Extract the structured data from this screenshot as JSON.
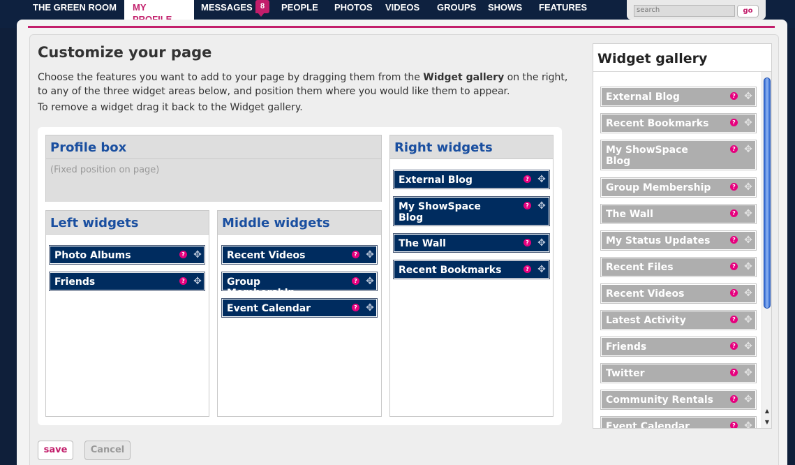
{
  "nav": {
    "items": [
      "THE GREEN ROOM",
      "MY PROFILE",
      "MESSAGES",
      "PEOPLE",
      "PHOTOS",
      "VIDEOS",
      "GROUPS",
      "SHOWS",
      "FEATURES"
    ],
    "active_line1": "MY",
    "active_line2": "PROFILE",
    "messages_count": "8",
    "search_placeholder": "search",
    "search_button": "go"
  },
  "page": {
    "title": "Customize your page",
    "intro_part1": "Choose the features you want to add to your page by dragging them from the ",
    "intro_bold": "Widget gallery",
    "intro_part2": " on the right, to any of the three widget areas below, and position them where you would like them to appear.",
    "intro2": "To remove a widget drag it back to the Widget gallery."
  },
  "zones": {
    "profile": {
      "title": "Profile box",
      "note": "(Fixed position on page)"
    },
    "left": {
      "title": "Left widgets",
      "widgets": [
        "Photo Albums",
        "Friends"
      ]
    },
    "middle": {
      "title": "Middle widgets",
      "widgets": [
        "Recent Videos",
        "Group Membership",
        "Event Calendar"
      ]
    },
    "right": {
      "title": "Right widgets",
      "widgets": [
        "External Blog",
        "My ShowSpace Blog",
        "The Wall",
        "Recent Bookmarks"
      ]
    }
  },
  "gallery": {
    "title": "Widget gallery",
    "widgets": [
      "External Blog",
      "Recent Bookmarks",
      "My ShowSpace Blog",
      "Group Membership",
      "The Wall",
      "My Status Updates",
      "Recent Files",
      "Recent Videos",
      "Latest Activity",
      "Friends",
      "Twitter",
      "Community Rentals",
      "Event Calendar"
    ]
  },
  "icons": {
    "help": "help-icon",
    "move": "move-icon"
  },
  "colors": {
    "accent": "#c21e6b",
    "widget_active": "#002c5f",
    "widget_gallery": "#aeaeae",
    "zone_title": "#1a4fa0"
  },
  "buttons": {
    "save": "save",
    "cancel": "Cancel"
  }
}
